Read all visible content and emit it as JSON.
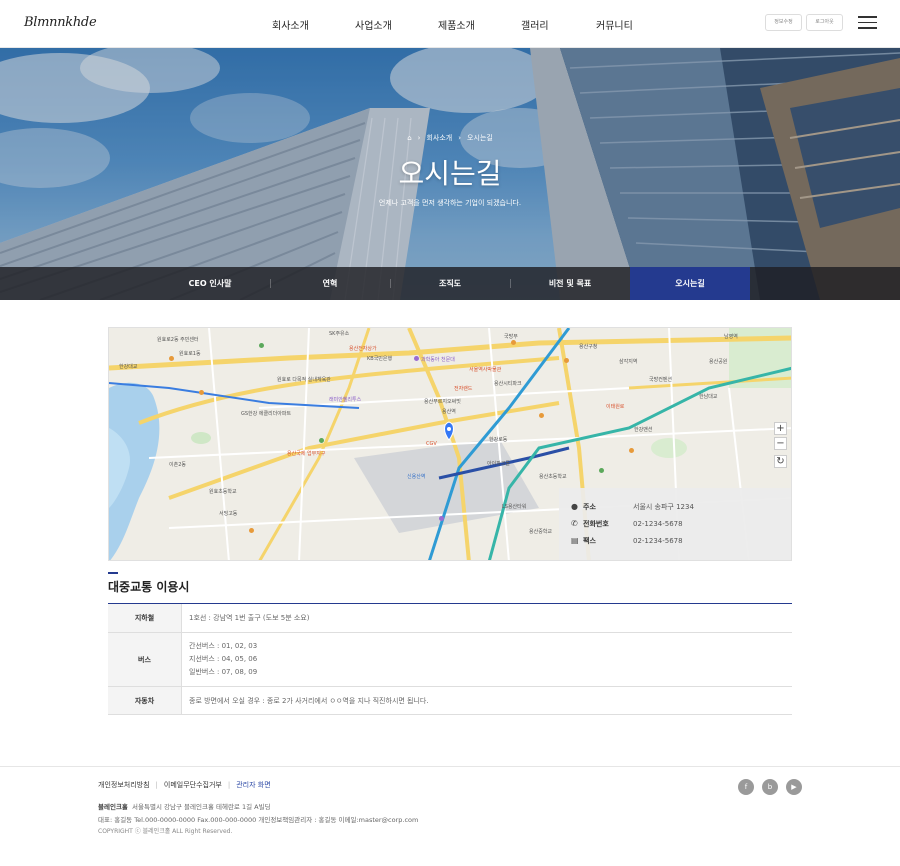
{
  "header": {
    "logo": "Blmnnkhde",
    "nav": [
      "회사소개",
      "사업소개",
      "제품소개",
      "갤러리",
      "커뮤니티"
    ],
    "util_buttons": [
      "정보수정",
      "로그아웃"
    ],
    "menu_icon": "hamburger-icon"
  },
  "hero": {
    "breadcrumb": [
      "회사소개",
      "오시는길"
    ],
    "home_icon": "home-icon",
    "title": "오시는길",
    "subtitle": "언제나 고객을 먼저 생각하는 기업이 되겠습니다.",
    "tabs": [
      {
        "label": "CEO 인사말",
        "active": false
      },
      {
        "label": "연혁",
        "active": false
      },
      {
        "label": "조직도",
        "active": false
      },
      {
        "label": "비전 및 목표",
        "active": false
      },
      {
        "label": "오시는길",
        "active": true
      }
    ],
    "active_color": "#243a8f"
  },
  "map": {
    "zoom_in": "+",
    "zoom_out": "−",
    "reset": "↻",
    "labels": [
      "원효로2동 주민센터",
      "원효로1동",
      "용산전자상가",
      "KB국민은행",
      "과학동아 천문대",
      "국방부",
      "용산구청",
      "전자랜드",
      "신용산역",
      "용산역",
      "한강대교",
      "이촌2동",
      "서빙고동",
      "용산국제 업무지구",
      "한강로동",
      "서울역사박물관",
      "이태원로",
      "용산시티파크",
      "SK주유소",
      "원효로 다목적 실내체육관",
      "GS한강 에클리더아파트",
      "래미안첼리투스",
      "용산푸르지오써밋",
      "아이파크몰",
      "CGV",
      "LS용산타워",
      "한강맨션",
      "용산초등학교",
      "삼각지역",
      "국방컨벤션",
      "원효초등학교",
      "용산중학교",
      "남영역",
      "한남대교",
      "용산공원"
    ],
    "info": {
      "address_label": "주소",
      "address": "서울시 송파구 1234",
      "phone_label": "전화번호",
      "phone": "02-1234-5678",
      "fax_label": "팩스",
      "fax": "02-1234-5678"
    }
  },
  "transport": {
    "title": "대중교통 이용시",
    "rows": [
      {
        "label": "지하철",
        "lines": [
          "1호선 : 강남역 1번 출구 (도보 5분 소요)"
        ]
      },
      {
        "label": "버스",
        "lines": [
          "간선버스 : 01, 02, 03",
          "지선버스 : 04, 05, 06",
          "일반버스 : 07, 08, 09"
        ]
      },
      {
        "label": "자동차",
        "lines": [
          "종로 방면에서 오실 경우 : 종로 2가 사거리에서 ㅇㅇ역을 지나 직진하시면 됩니다."
        ]
      }
    ]
  },
  "footer": {
    "links": [
      "개인정보처리방침",
      "이메일무단수집거부",
      "관리자 화면"
    ],
    "company": "블레인크홀",
    "address": "서울특별시 강남구 블레인크홀 테헤란로 1길 A빌딩",
    "line2": "대표: 홍길동   Tel.000-0000-0000   Fax.000-000-0000   개인정보책임관리자 : 홍길동 이메일:master@corp.com",
    "copyright": "COPYRIGHT ⓒ 블레인크홀 ALL Right Reserved.",
    "sns": [
      "f",
      "b",
      "▶"
    ]
  }
}
